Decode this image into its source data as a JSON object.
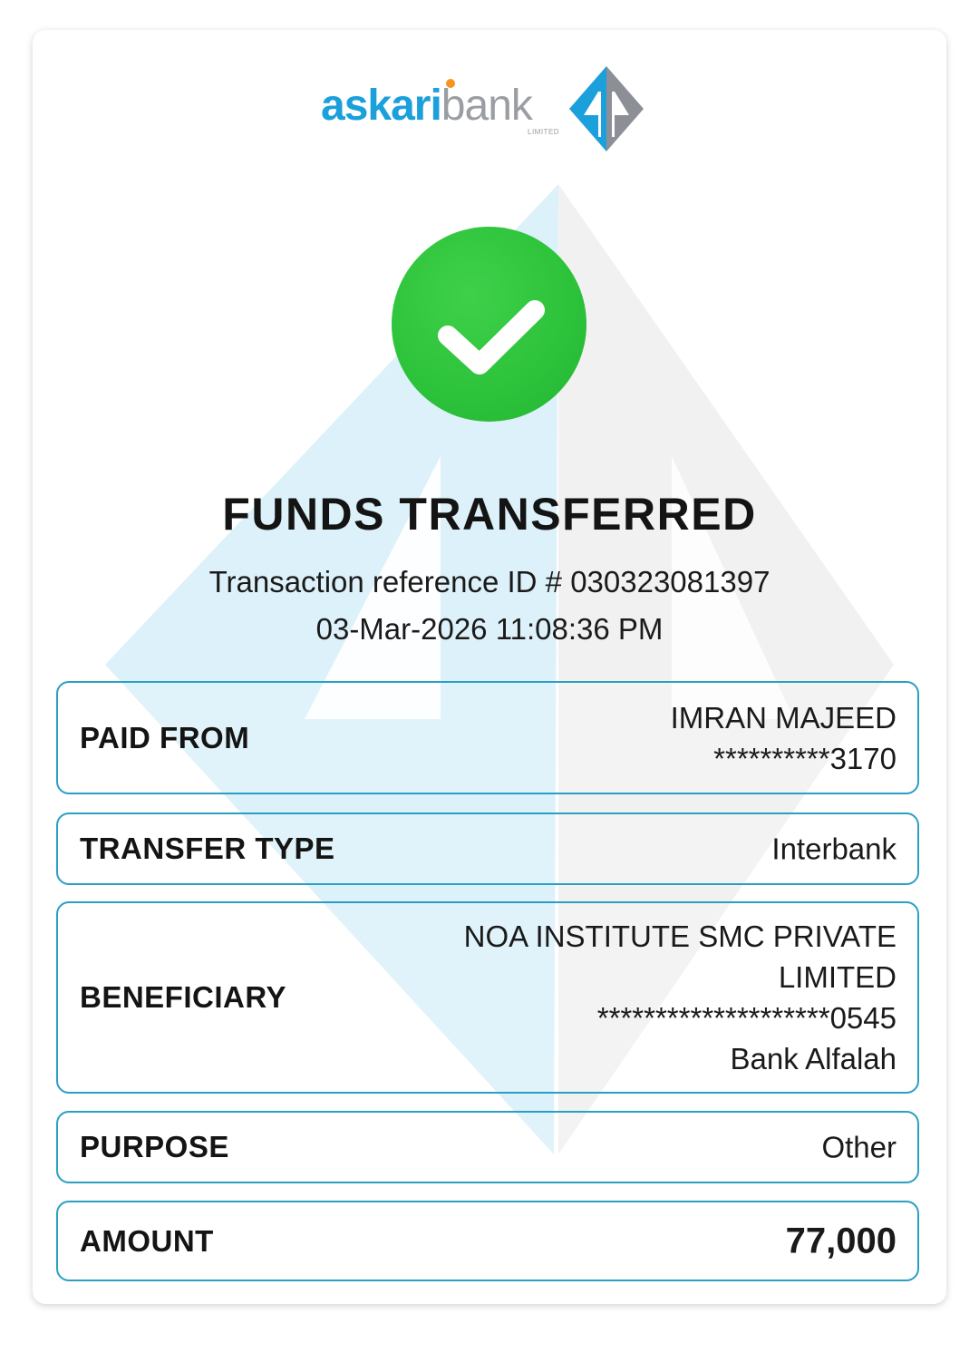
{
  "logo": {
    "brand_primary": "askari",
    "brand_secondary": "bank",
    "brand_sub": "LIMITED",
    "colors": {
      "blue": "#1ba0dc",
      "grey": "#9a9ea3",
      "accent": "#f7941d"
    }
  },
  "status": {
    "icon": "check-icon",
    "color": "#2cc23a",
    "title": "FUNDS TRANSFERRED"
  },
  "transaction": {
    "reference_line": "Transaction reference ID # 030323081397",
    "datetime": "03-Mar-2026 11:08:36 PM"
  },
  "details": {
    "paid_from": {
      "label": "PAID FROM",
      "name": "IMRAN MAJEED",
      "account": "**********3170"
    },
    "transfer_type": {
      "label": "TRANSFER TYPE",
      "value": "Interbank"
    },
    "beneficiary": {
      "label": "BENEFICIARY",
      "name_line1": "NOA INSTITUTE SMC PRIVATE",
      "name_line2": "LIMITED",
      "account": "********************0545",
      "bank": "Bank Alfalah"
    },
    "purpose": {
      "label": "PURPOSE",
      "value": "Other"
    },
    "amount": {
      "label": "AMOUNT",
      "value": "77,000"
    }
  },
  "border_color": "#2a9fc4"
}
